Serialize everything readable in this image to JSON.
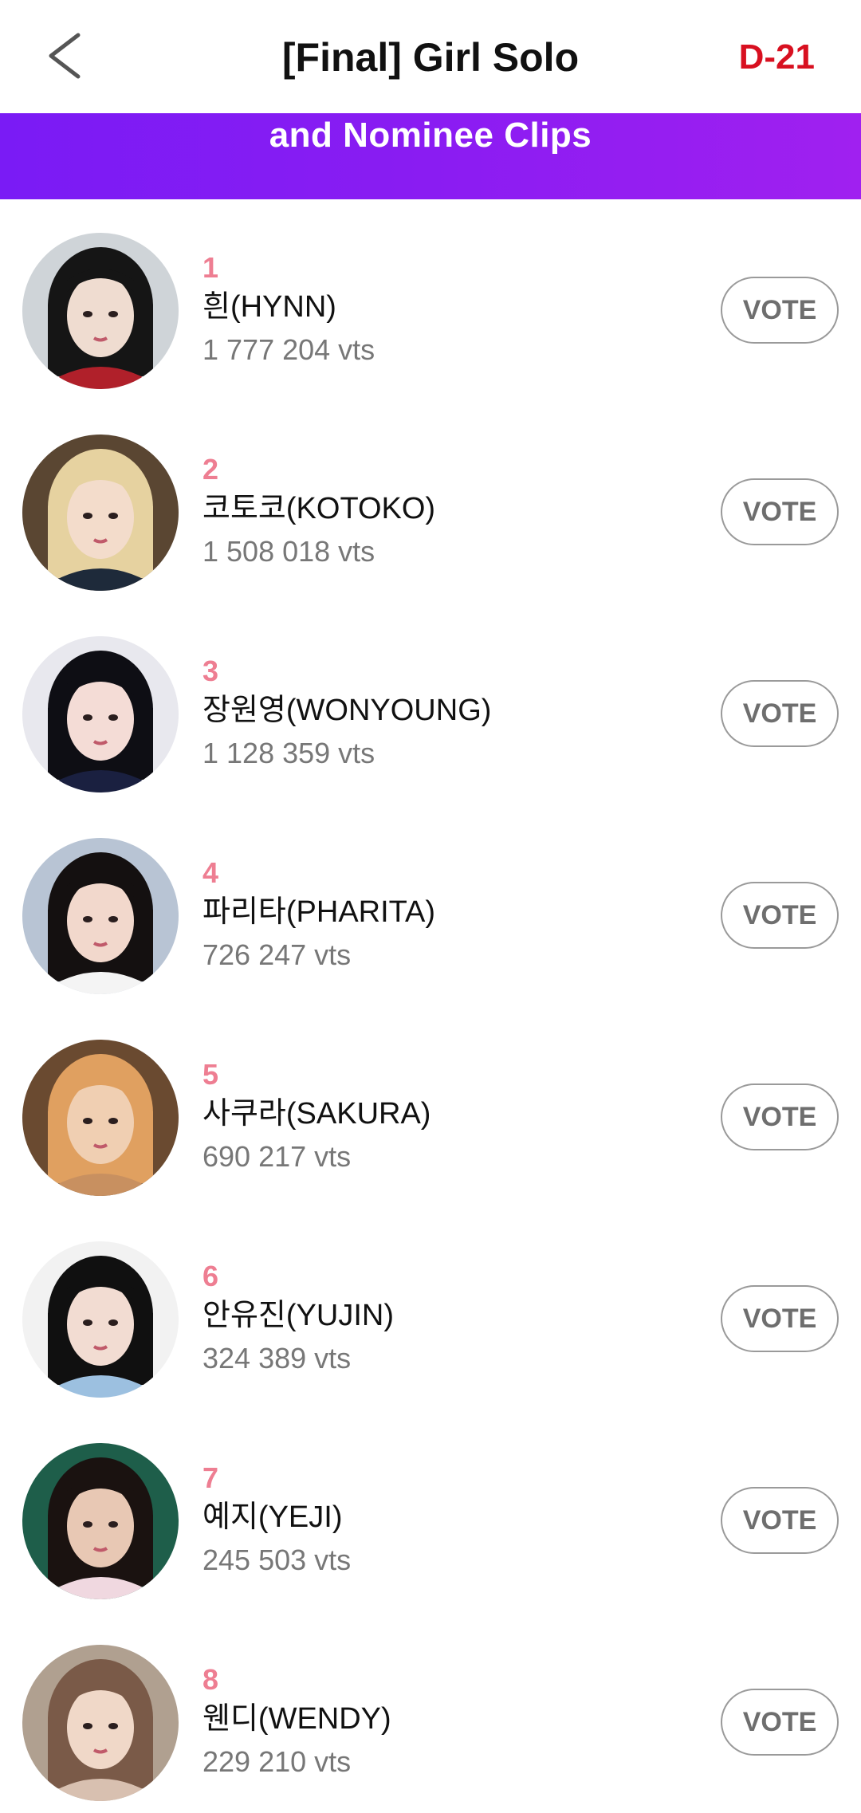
{
  "header": {
    "title": "[Final] Girl Solo",
    "dday": "D-21"
  },
  "banner": {
    "text": "and Nominee Clips"
  },
  "nominees": [
    {
      "rank": "1",
      "name": "흰(HYNN)",
      "votes": "1 777 204 vts",
      "vote_label": "VOTE",
      "bg": "#cfd4d8",
      "hair": "#151515",
      "skin": "#efdcd0",
      "accent": "#b0202a"
    },
    {
      "rank": "2",
      "name": "코토코(KOTOKO)",
      "votes": "1 508 018 vts",
      "vote_label": "VOTE",
      "bg": "#5a4632",
      "hair": "#e6d2a0",
      "skin": "#f3dccb",
      "accent": "#1e2a3a"
    },
    {
      "rank": "3",
      "name": "장원영(WONYOUNG)",
      "votes": "1 128 359 vts",
      "vote_label": "VOTE",
      "bg": "#e8e8ee",
      "hair": "#0e0e14",
      "skin": "#f4dcd6",
      "accent": "#1a2040"
    },
    {
      "rank": "4",
      "name": "파리타(PHARITA)",
      "votes": "726 247 vts",
      "vote_label": "VOTE",
      "bg": "#b8c4d4",
      "hair": "#141010",
      "skin": "#f2d8cc",
      "accent": "#f4f4f4"
    },
    {
      "rank": "5",
      "name": "사쿠라(SAKURA)",
      "votes": "690 217 vts",
      "vote_label": "VOTE",
      "bg": "#6a4a30",
      "hair": "#e0a060",
      "skin": "#f0cfb2",
      "accent": "#c89060"
    },
    {
      "rank": "6",
      "name": "안유진(YUJIN)",
      "votes": "324 389 vts",
      "vote_label": "VOTE",
      "bg": "#f2f2f2",
      "hair": "#101010",
      "skin": "#f2dcd2",
      "accent": "#9cc0e0"
    },
    {
      "rank": "7",
      "name": "예지(YEJI)",
      "votes": "245 503 vts",
      "vote_label": "VOTE",
      "bg": "#1e5e4a",
      "hair": "#1a1210",
      "skin": "#e8c8b4",
      "accent": "#f0d8e0"
    },
    {
      "rank": "8",
      "name": "웬디(WENDY)",
      "votes": "229 210 vts",
      "vote_label": "VOTE",
      "bg": "#b0a090",
      "hair": "#7a5a48",
      "skin": "#f0d8c8",
      "accent": "#d8c0b0"
    }
  ]
}
